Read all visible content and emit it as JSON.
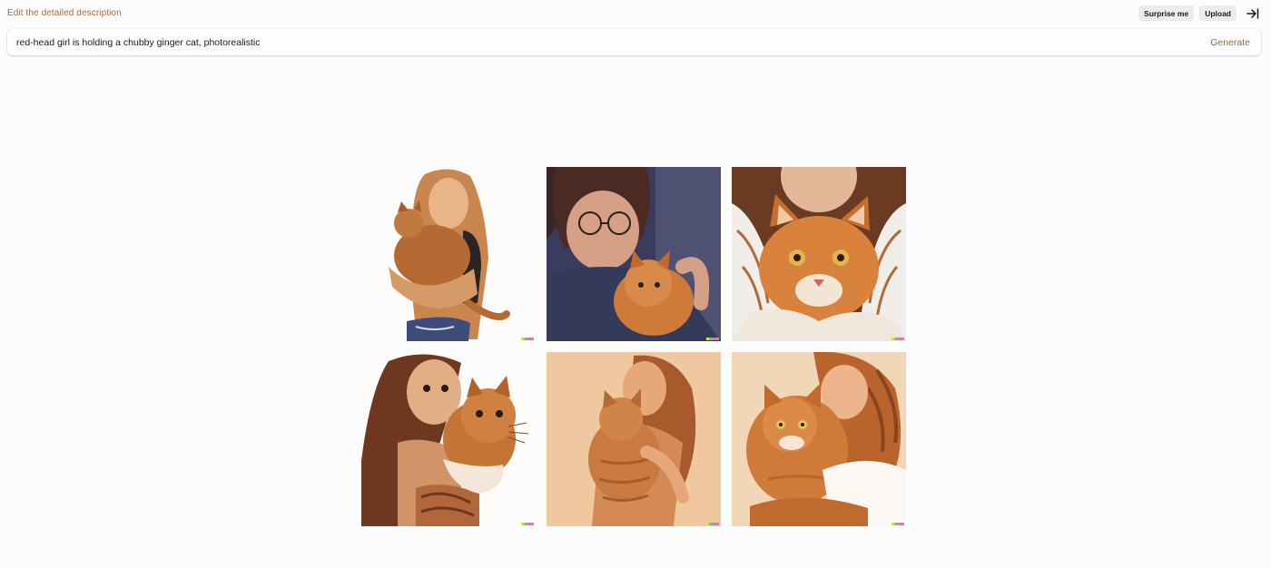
{
  "header": {
    "label": "Edit the detailed description",
    "surprise_label": "Surprise me",
    "upload_label": "Upload",
    "collapse_icon": "arrow-right-to-bar-icon"
  },
  "prompt": {
    "value": "red-head girl is holding a chubby ginger cat, photorealistic",
    "generate_label": "Generate"
  },
  "results": {
    "images": [
      {
        "id": 1,
        "subject": "illustrated red-haired girl holding orange cat on white background"
      },
      {
        "id": 2,
        "subject": "girl with glasses holding ginger cat, dark blue background"
      },
      {
        "id": 3,
        "subject": "close-up of chubby ginger cat held against striped shirt"
      },
      {
        "id": 4,
        "subject": "cartoon girl with long brown hair hugging tabby cat"
      },
      {
        "id": 5,
        "subject": "flat illustration of girl hugging orange cat, beige background"
      },
      {
        "id": 6,
        "subject": "painted girl with wavy red hair cuddling ginger cat"
      }
    ]
  },
  "colors": {
    "accent_text": "#a06b3c",
    "generate_text": "#8d6a4a",
    "watermark": [
      "#f2d34a",
      "#61c7a4",
      "#7aa8e0",
      "#e87a6a",
      "#b48ad8"
    ]
  }
}
